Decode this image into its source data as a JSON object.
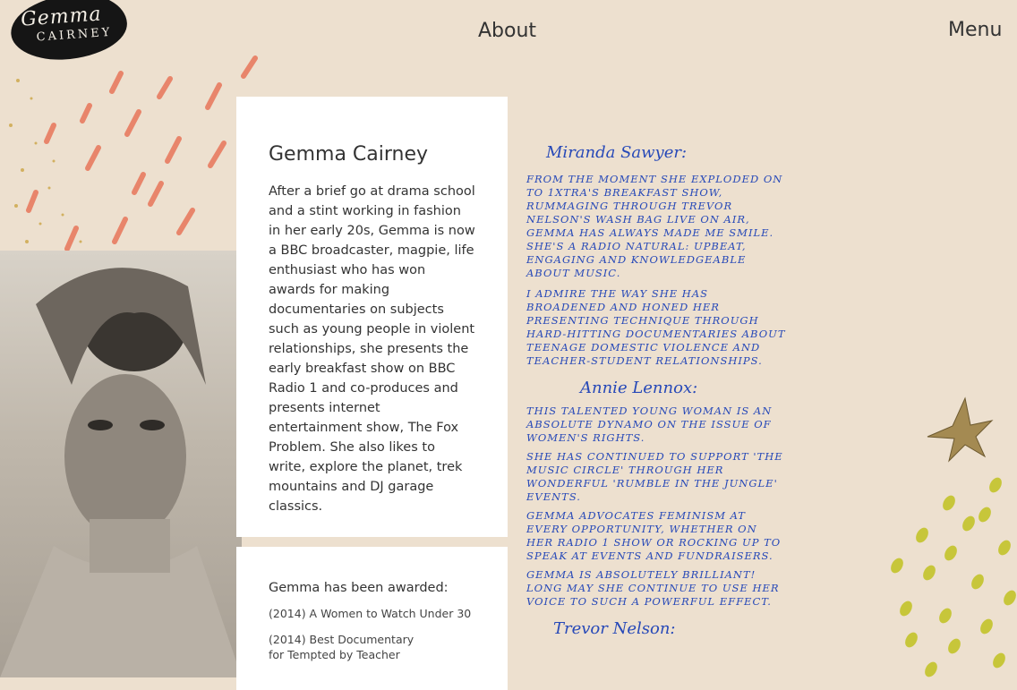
{
  "logo": {
    "line1": "Gemma",
    "line2": "CAIRNEY"
  },
  "nav": {
    "about": "About",
    "menu": "Menu"
  },
  "bio": {
    "title": "Gemma Cairney",
    "text": "After a brief go at drama school and a stint working in fashion in her early 20s, Gemma is now a BBC broadcaster, magpie, life enthusiast who has won awards for making documentaries on subjects such as young people in violent relationships, she presents the early breakfast show on BBC Radio 1 and co-produces and presents internet entertainment show, The Fox Problem. She also likes to write, explore the planet, trek mountains and DJ garage classics."
  },
  "awards": {
    "heading": "Gemma has been awarded:",
    "items": [
      {
        "line1": "(2014) A Women to Watch Under 30",
        "line2": ""
      },
      {
        "line1": "(2014) Best Documentary",
        "line2": "for Tempted by Teacher"
      }
    ]
  },
  "testimonials": {
    "author1": "Miranda Sawyer:",
    "quote1a": "From the moment she exploded on to 1Xtra's breakfast show, rummaging through Trevor Nelson's wash bag live on air, Gemma has always made me smile. She's a radio natural: upbeat, engaging and knowledgeable about music.",
    "quote1b": "I admire the way she has broadened and honed her presenting technique through hard-hitting documentaries about teenage domestic violence and teacher-student relationships.",
    "author2": "Annie Lennox:",
    "quote2a": "This talented young woman is an absolute dynamo on the issue of women's rights.",
    "quote2b": "She has continued to support 'The Music Circle' through her wonderful 'Rumble in the Jungle' events.",
    "quote2c": "Gemma advocates feminism at every opportunity, whether on her Radio 1 show or rocking up to speak at events and fundraisers.",
    "quote2d": "Gemma is absolutely brilliant! Long may she continue to use her voice to such a powerful effect.",
    "author3": "Trevor Nelson:"
  },
  "colors": {
    "background": "#ede0cf",
    "handwriting": "#2749b8",
    "brush_orange": "#e8765a",
    "gold": "#c9a13b",
    "dots_yellow": "#c7c63a"
  }
}
